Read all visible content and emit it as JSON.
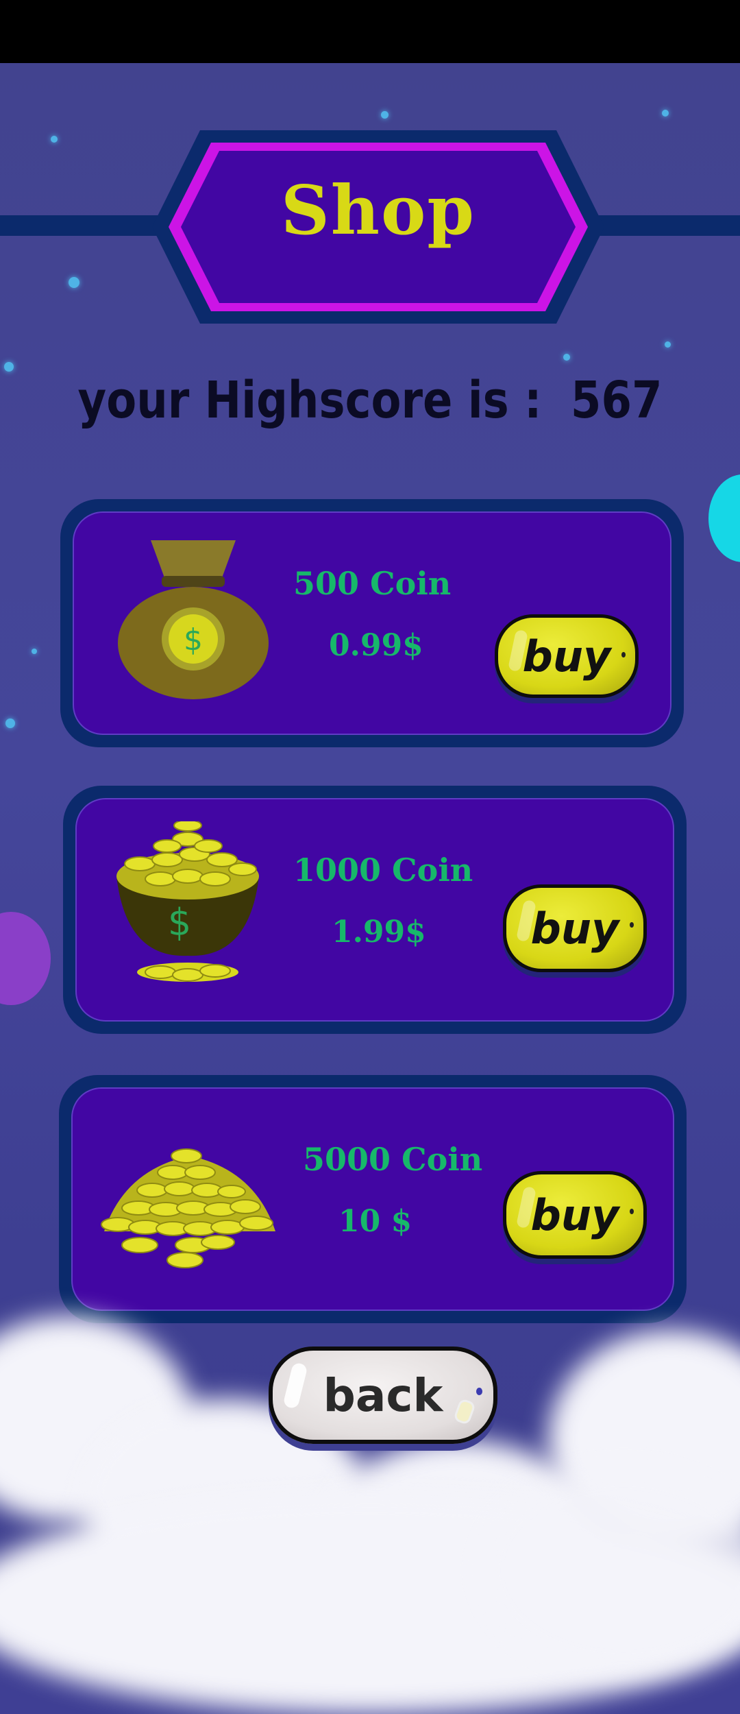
{
  "shop": {
    "title": "Shop",
    "highscore_label": "your Highscore is :",
    "highscore_value": "567"
  },
  "offers": [
    {
      "coins": "500 Coin",
      "price": "0.99$",
      "buy_label": "buy",
      "icon": "coin-bag-icon"
    },
    {
      "coins": "1000 Coin",
      "price": "1.99$",
      "buy_label": "buy",
      "icon": "coin-pot-icon"
    },
    {
      "coins": "5000 Coin",
      "price": "10 $",
      "buy_label": "buy",
      "icon": "coin-pile-icon"
    }
  ],
  "back_label": "back",
  "colors": {
    "background": "#42438f",
    "card_border": "#0b2a6c",
    "card_fill": "#4206a3",
    "accent_text": "#17b86a",
    "title_yellow": "#d8d916",
    "banner_border": "#cc14e6",
    "buy_button": "#d8d716"
  }
}
